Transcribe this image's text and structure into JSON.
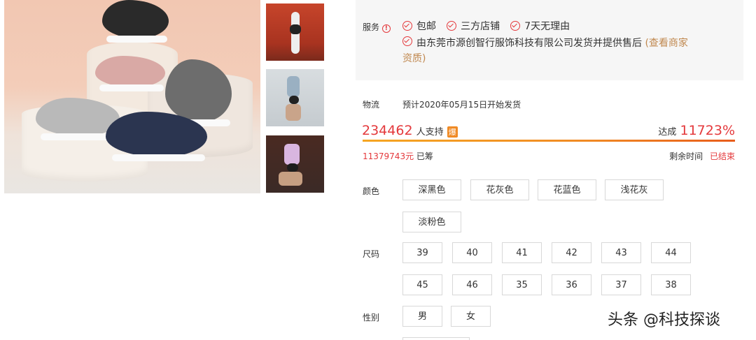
{
  "service": {
    "label": "服务",
    "items": [
      "包邮",
      "三方店铺",
      "7天无理由"
    ],
    "seller_line": "由东莞市源创智行服饰科技有限公司发货并提供售后",
    "seller_link_a": "(查看商家",
    "seller_link_b": "资质)"
  },
  "logistics": {
    "label": "物流",
    "text": "预计2020年05月15日开始发货"
  },
  "crowdfunding": {
    "supporters": "234462",
    "supporters_label": "人支持",
    "hot_badge": "爆",
    "reach_label": "达成",
    "reach_percent": "11723%",
    "progress_fraction": 1.0,
    "raised_amount": "11379743元",
    "raised_label": "已筹",
    "remaining_label": "剩余时间",
    "remaining_value": "已结束"
  },
  "color": {
    "label": "颜色",
    "options": [
      "深黑色",
      "花灰色",
      "花蓝色",
      "浅花灰",
      "淡粉色"
    ]
  },
  "size": {
    "label": "尺码",
    "options": [
      "39",
      "40",
      "41",
      "42",
      "43",
      "44",
      "45",
      "46",
      "35",
      "36",
      "37",
      "38"
    ]
  },
  "gender": {
    "label": "性别",
    "options": [
      "男",
      "女"
    ]
  },
  "watermark": "头条 @科技探谈",
  "colors": {
    "accent_red": "#e4393c",
    "link_brown": "#c0884f",
    "service_bg": "#f6f6f6"
  }
}
